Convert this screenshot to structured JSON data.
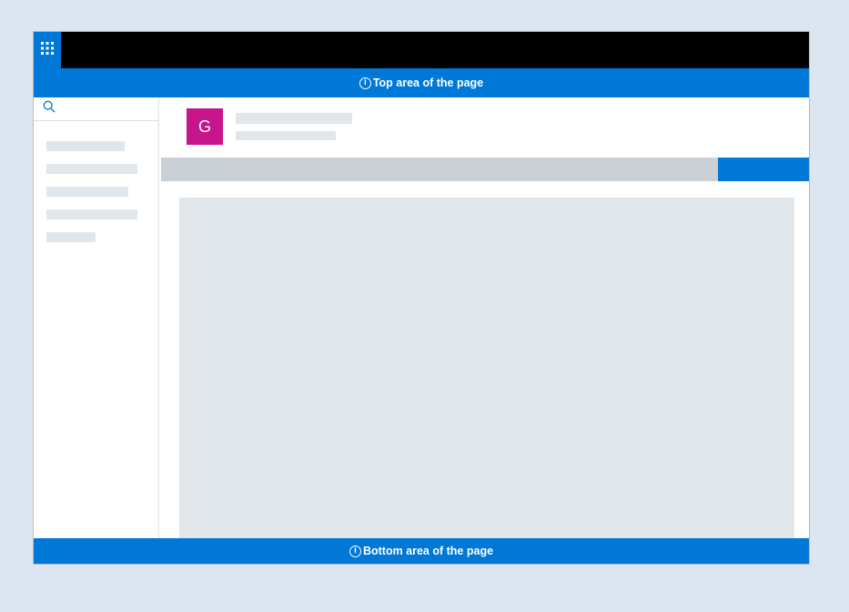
{
  "title_bar": {
    "app_title": ""
  },
  "callouts": {
    "top": "Top area of the page",
    "bottom": "Bottom area of the page",
    "info_glyph": "i"
  },
  "search": {
    "placeholder": "Search"
  },
  "profile": {
    "avatar_initial": "G",
    "display_name": "",
    "sub_text": ""
  },
  "action_button": {
    "label": ""
  },
  "nav": {
    "items": [
      "",
      "",
      "",
      "",
      ""
    ]
  },
  "colors": {
    "accent": "#0078d7",
    "avatar": "#c7158b",
    "placeholder": "#e1e6ea",
    "title_bar": "#000000"
  }
}
